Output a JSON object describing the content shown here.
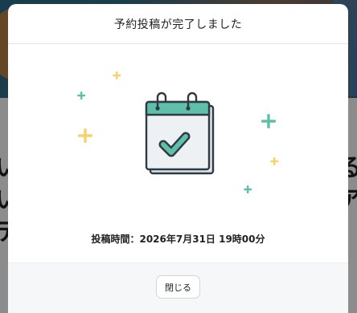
{
  "background_page": {
    "heading_row1_left": "い",
    "heading_row1_right": "る",
    "heading_row2_left": "い",
    "heading_row2_right": "ア",
    "heading_row3_left": "テ"
  },
  "modal": {
    "title": "予約投稿が完了しました",
    "schedule_label": "投稿時間：",
    "schedule_value": "2026年7月31日 19時00分",
    "close_label": "閉じる"
  },
  "colors": {
    "accent_teal": "#5fbfa8",
    "sparkle_yellow": "#f5d36a",
    "calendar_outline": "#2f3b44"
  },
  "icons": [
    "calendar-check-icon",
    "sparkle-icon"
  ]
}
